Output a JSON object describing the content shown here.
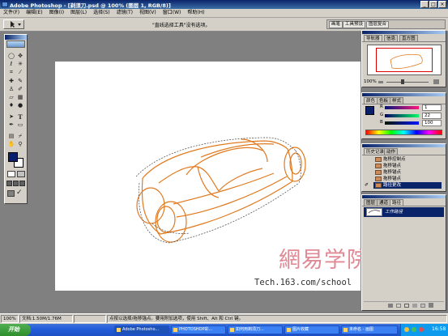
{
  "window": {
    "title": "Adobe Photoshop - [剃须刀.psd @ 100% (图层 1, RGB/8)]",
    "controls": [
      "_",
      "□",
      "×"
    ]
  },
  "menu": [
    "文件(F)",
    "编辑(E)",
    "图像(I)",
    "图层(L)",
    "选择(S)",
    "滤镜(T)",
    "视图(V)",
    "窗口(W)",
    "帮助(H)"
  ],
  "options_bar": {
    "hint": "\"直线选择工具\"没有选项。"
  },
  "palette_well": {
    "tabs": [
      "画笔",
      "工具预设",
      "图层复合"
    ]
  },
  "toolbox": {
    "tools": [
      "marquee-tool",
      "move-tool",
      "lasso-tool",
      "magic-wand-tool",
      "crop-tool",
      "slice-tool",
      "healing-brush-tool",
      "brush-tool",
      "clone-stamp-tool",
      "history-brush-tool",
      "eraser-tool",
      "gradient-tool",
      "blur-tool",
      "dodge-tool",
      "path-selection-tool",
      "type-tool",
      "pen-tool",
      "shape-tool",
      "notes-tool",
      "eyedropper-tool",
      "hand-tool",
      "zoom-tool"
    ],
    "foreground_color": "#0a1f6b",
    "background_color": "#ffffff"
  },
  "navigator": {
    "tabs": [
      "导航器",
      "信息",
      "直方图"
    ],
    "zoom": "100%"
  },
  "color_panel": {
    "tabs": [
      "颜色",
      "色板",
      "样式"
    ],
    "channels": [
      {
        "label": "R",
        "value": "1"
      },
      {
        "label": "G",
        "value": "22"
      },
      {
        "label": "B",
        "value": "100"
      }
    ]
  },
  "history_panel": {
    "tabs": [
      "历史记录",
      "动作"
    ],
    "items": [
      "拖移控制点",
      "拖移锚点",
      "拖移锚点",
      "拖移锚点",
      "路径更改"
    ],
    "selected_index": 4
  },
  "layers_panel": {
    "tabs": [
      "图层",
      "通道",
      "路径"
    ],
    "items": [
      "工作路径"
    ]
  },
  "status_bar": {
    "zoom": "100%",
    "doc": "文档:1.50M/1.76M",
    "hint": "点按以选择/拖移锚点。要用附加选项，使用 Shift、Alt 和 Ctrl 键。"
  },
  "taskbar": {
    "start": "开始",
    "items": [
      "Adobe Photosho...",
      "PHOTOSHOP彩...",
      "如何用剃须刀...",
      "图片收藏",
      "未命名 - 画图"
    ],
    "active_index": 0,
    "clock": "16:58"
  },
  "watermark": {
    "logo": "網易学院",
    "url": "Tech.163.com/school"
  },
  "colors": {
    "stroke": "#e07a1f",
    "guide": "#444444",
    "title_bar": "#0a246a",
    "taskbar": "#245edb"
  }
}
